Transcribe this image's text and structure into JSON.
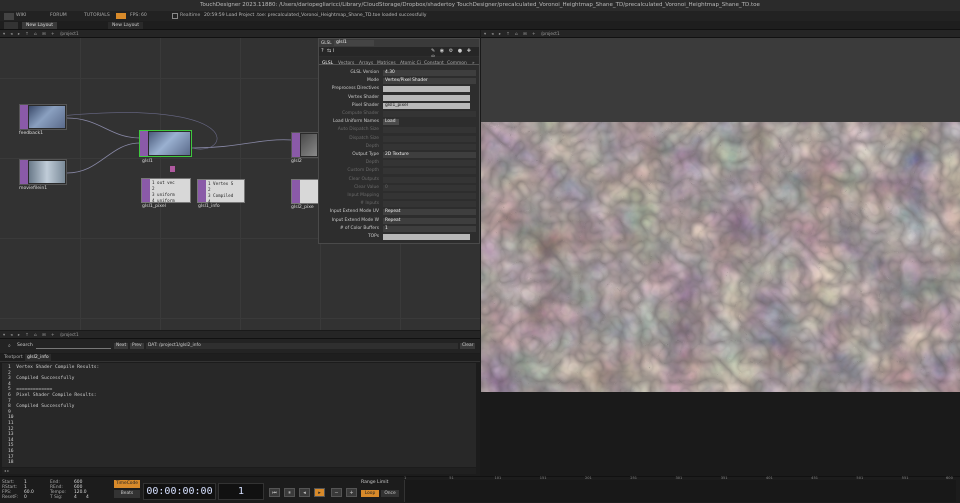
{
  "window": {
    "title": "TouchDesigner 2023.11880: /Users/dariopegliaricci/Library/CloudStorage/Dropbox/shadertoy TouchDesigner/precalculated_Voronoi_Heightmap_Shane_TD/precalculated_Voronoi_Heightmap_Shane_TD.toe"
  },
  "menubar": {
    "wiki": "WIKI",
    "forum": "FORUM",
    "tutorials": "TUTORIALS",
    "fps_label": "FPS:",
    "fps_value": "60",
    "realtime": "Realtime",
    "status": "20:59:59 Load Project .toe: precalculated_Voronoi_Heightmap_Shane_TD.toe loaded successfully"
  },
  "layout_bar": {
    "new_layout_1": "New Layout",
    "new_layout_2": "New Layout"
  },
  "network_pane": {
    "path": "/project1",
    "nodes": {
      "feedback1": "feedback1",
      "moviefilein1": "moviefilein1",
      "glsl1": "glsl1",
      "glsl2": "glsl2",
      "glsl1_pixel": "glsl1_pixel",
      "glsl1_info": "glsl1_info",
      "glsl2_pixel": "glsl2_pixe"
    },
    "dat_pixel_lines": [
      "1 out vec",
      "2",
      "3 uniform",
      "4 uniform"
    ],
    "dat_info_lines": [
      "1 Vertex S",
      "2",
      "3 Compiled",
      "4"
    ]
  },
  "params": {
    "op_type": "GLSL",
    "op_name": "glsl1",
    "tabs": [
      "GLSL",
      "Vectors",
      "Arrays",
      "Matrices",
      "Atomic Ci",
      "Constant",
      "Common"
    ],
    "rows": [
      {
        "label": "GLSL Version",
        "value": "4.30",
        "kind": "menu",
        "dim": false
      },
      {
        "label": "Mode",
        "value": "Vertex/Pixel Shader",
        "kind": "menu",
        "dim": false
      },
      {
        "label": "Preprocess Directives",
        "value": "",
        "kind": "field",
        "dim": false
      },
      {
        "label": "Vertex Shader",
        "value": "",
        "kind": "field",
        "dim": false
      },
      {
        "label": "Pixel Shader",
        "value": "glsl1_pixel",
        "kind": "field",
        "dim": false
      },
      {
        "label": "Compute Shader",
        "value": "",
        "kind": "dimf",
        "dim": true
      },
      {
        "label": "Load Uniform Names",
        "value": "Load",
        "kind": "btn",
        "dim": false
      },
      {
        "label": "Auto Dispatch Size",
        "value": "",
        "kind": "dimf",
        "dim": true
      },
      {
        "label": "Dispatch Size",
        "value": "",
        "kind": "dimf",
        "dim": true
      },
      {
        "label": "Depth",
        "value": "",
        "kind": "dimf",
        "dim": true
      },
      {
        "label": "Output Type",
        "value": "2D Texture",
        "kind": "menu",
        "dim": false
      },
      {
        "label": "Depth",
        "value": "",
        "kind": "dimf",
        "dim": true
      },
      {
        "label": "Custom Depth",
        "value": "",
        "kind": "dimf",
        "dim": true
      },
      {
        "label": "Clear Outputs",
        "value": "",
        "kind": "dimf",
        "dim": true
      },
      {
        "label": "Clear Value",
        "value": "0",
        "kind": "dimf",
        "dim": true
      },
      {
        "label": "Input Mapping",
        "value": "",
        "kind": "dimf",
        "dim": true
      },
      {
        "label": "# Inputs",
        "value": "",
        "kind": "dimf",
        "dim": true
      },
      {
        "label": "Input Extend Mode UV",
        "value": "Repeat",
        "kind": "menu",
        "dim": false
      },
      {
        "label": "Input Extend Mode W",
        "value": "Repeat",
        "kind": "menu",
        "dim": false
      },
      {
        "label": "# of Color Buffers",
        "value": "1",
        "kind": "menu",
        "dim": false
      },
      {
        "label": "TOPs",
        "value": "",
        "kind": "field",
        "dim": false
      }
    ]
  },
  "viewer": {
    "path": "/project1"
  },
  "textport": {
    "search_label": "Search",
    "next": "Next",
    "prev": "Prev",
    "dat_path": "DAT: /project1/glsl2_info",
    "clear": "Clear",
    "tabs": [
      "Textport",
      "glsl2_info"
    ],
    "lines": [
      "1  Vertex Shader Compile Results:",
      "2",
      "3  Compiled Successfully",
      "4",
      "5  =============",
      "6  Pixel Shader Compile Results:",
      "7",
      "8  Compiled Successfully",
      "9",
      "10",
      "11",
      "12",
      "13",
      "14",
      "15",
      "16",
      "17",
      "18"
    ]
  },
  "timeline": {
    "start_label": "Start:",
    "start_value": "1",
    "end_label": "End:",
    "end_value": "600",
    "rstart_label": "RStart:",
    "rstart_value": "1",
    "rend_label": "REnd:",
    "rend_value": "600",
    "fps_label": "FPS:",
    "fps_value": "60.0",
    "tempo_label": "Tempo:",
    "tempo_value": "120.0",
    "resetf_label": "ResetF:",
    "resetf_value": "0",
    "tsig_label": "T Sig:",
    "tsig_a": "4",
    "tsig_b": "4",
    "timecode_btn": "TimeCode",
    "beats_btn": "Beats",
    "timecode": "00:00:00:00",
    "frame": "1",
    "range_limit": "Range Limit",
    "loop": "Loop",
    "once": "Once",
    "ticks": [
      "1",
      "51",
      "101",
      "151",
      "201",
      "251",
      "301",
      "351",
      "401",
      "451",
      "501",
      "551",
      "600"
    ]
  }
}
